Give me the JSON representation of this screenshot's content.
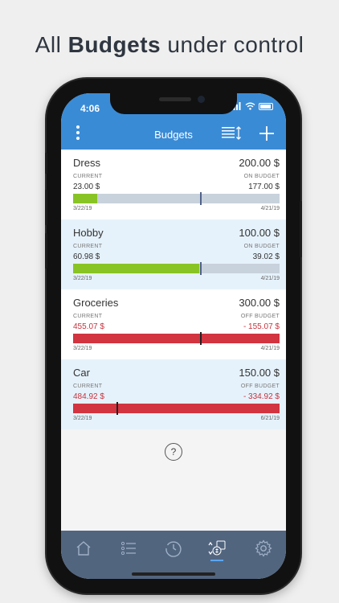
{
  "headline": {
    "pre": "All ",
    "bold": "Budgets",
    "post": " under control"
  },
  "status": {
    "time": "4:06"
  },
  "appbar": {
    "title": "Budgets"
  },
  "budgets": [
    {
      "name": "Dress",
      "amount": "200.00 $",
      "left_label": "CURRENT",
      "left_value": "23.00 $",
      "right_label": "ON BUDGET",
      "right_value": "177.00 $",
      "start": "3/22/19",
      "end": "4/21/19",
      "progress": 0.115,
      "time_marker": 0.615,
      "over": false
    },
    {
      "name": "Hobby",
      "amount": "100.00 $",
      "left_label": "CURRENT",
      "left_value": "60.98 $",
      "right_label": "ON BUDGET",
      "right_value": "39.02 $",
      "start": "3/22/19",
      "end": "4/21/19",
      "progress": 0.61,
      "time_marker": 0.615,
      "over": false
    },
    {
      "name": "Groceries",
      "amount": "300.00 $",
      "left_label": "CURRENT",
      "left_value": "455.07 $",
      "right_label": "OFF BUDGET",
      "right_value": "- 155.07 $",
      "start": "3/22/19",
      "end": "4/21/19",
      "progress": 1.0,
      "time_marker": 0.615,
      "over": true
    },
    {
      "name": "Car",
      "amount": "150.00 $",
      "left_label": "CURRENT",
      "left_value": "484.92 $",
      "right_label": "OFF BUDGET",
      "right_value": "- 334.92 $",
      "start": "3/22/19",
      "end": "6/21/19",
      "progress": 1.0,
      "time_marker": 0.21,
      "over": true
    }
  ],
  "help": {
    "symbol": "?"
  },
  "tabs": [
    {
      "icon": "home-icon"
    },
    {
      "icon": "list-icon"
    },
    {
      "icon": "history-icon"
    },
    {
      "icon": "budget-coins-icon",
      "active": true
    },
    {
      "icon": "gear-icon"
    }
  ],
  "colors": {
    "appbar": "#3a8bd6",
    "tabbar": "#52657f",
    "green": "#88c425",
    "red": "#d23440",
    "track": "#c8d2dc"
  }
}
